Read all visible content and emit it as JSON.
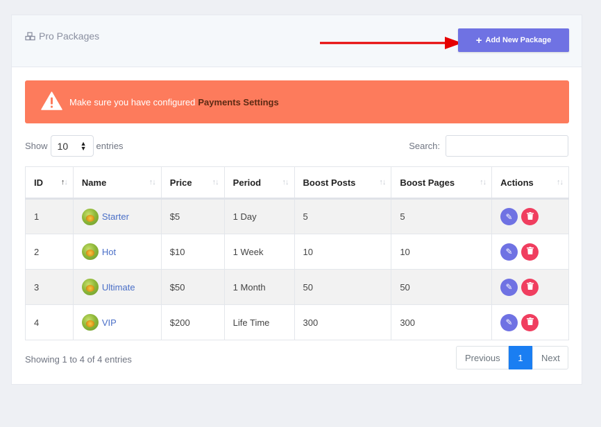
{
  "header": {
    "title": "Pro Packages",
    "title_icon": "cubes-icon",
    "add_button_label": "Add New Package"
  },
  "alert": {
    "text": "Make sure you have configured",
    "link": "Payments Settings",
    "icon": "warning-icon"
  },
  "controls": {
    "show_label": "Show",
    "entries_value": "10",
    "entries_label": "entries",
    "search_label": "Search:",
    "search_value": ""
  },
  "table": {
    "columns": [
      "ID",
      "Name",
      "Price",
      "Period",
      "Boost Posts",
      "Boost Pages",
      "Actions"
    ],
    "rows": [
      {
        "id": "1",
        "name": "Starter",
        "price": "$5",
        "period": "1 Day",
        "boost_posts": "5",
        "boost_pages": "5"
      },
      {
        "id": "2",
        "name": "Hot",
        "price": "$10",
        "period": "1 Week",
        "boost_posts": "10",
        "boost_pages": "10"
      },
      {
        "id": "3",
        "name": "Ultimate",
        "price": "$50",
        "period": "1 Month",
        "boost_posts": "50",
        "boost_pages": "50"
      },
      {
        "id": "4",
        "name": "VIP",
        "price": "$200",
        "period": "Life Time",
        "boost_posts": "300",
        "boost_pages": "300"
      }
    ]
  },
  "footer": {
    "info": "Showing 1 to 4 of 4 entries",
    "prev_label": "Previous",
    "current_page": "1",
    "next_label": "Next"
  },
  "colors": {
    "accent": "#6f72e3",
    "alert": "#fd7b5c",
    "danger": "#f03e5f",
    "page_active": "#1a7ef2",
    "arrow": "#e60000"
  }
}
